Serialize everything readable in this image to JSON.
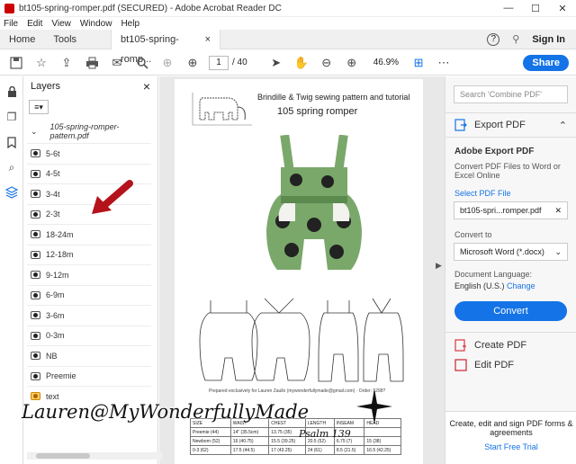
{
  "window": {
    "title": "bt105-spring-romper.pdf (SECURED) - Adobe Acrobat Reader DC",
    "minimize": "—",
    "maximize": "☐",
    "close": "✕"
  },
  "menu": [
    "File",
    "Edit",
    "View",
    "Window",
    "Help"
  ],
  "tabs": {
    "home": "Home",
    "tools": "Tools",
    "doc": "bt105-spring-romp...",
    "doc_close": "×"
  },
  "header_right": {
    "help_icon": "?",
    "bell_icon": "🔔",
    "signin": "Sign In"
  },
  "toolbar": {
    "page_current": "1",
    "page_total": "/ 40",
    "zoom": "46.9%",
    "share": "Share"
  },
  "layers_panel": {
    "title": "Layers",
    "close": "×",
    "root_label": "105-spring-romper-pattern.pdf",
    "items": [
      "5-6t",
      "4-5t",
      "3-4t",
      "2-3t",
      "18-24m",
      "12-18m",
      "9-12m",
      "6-9m",
      "3-6m",
      "0-3m",
      "NB",
      "Preemie",
      "text"
    ]
  },
  "page": {
    "title_line1": "Brindille & Twig sewing pattern and tutorial",
    "title_line2": "105 spring romper",
    "prepared": "Prepared exclusively for Lauren Zaullo (mywonderfullymade@gmail.com) · Order: 1298?",
    "table_rows": [
      [
        "SIZE",
        "WAIST",
        "CHEST",
        "LENGTH",
        "INSEAM",
        "HEAD"
      ],
      [
        "Preemie (44)",
        "14\" (35.5cm)",
        "13.75 (35)",
        "",
        "",
        ""
      ],
      [
        "Newborn (52)",
        "16 (40.75)",
        "15.5 (39.25)",
        "20.5 (52)",
        "6.75 (7)",
        "15 (38)"
      ],
      [
        "0-3 (62)",
        "17.5 (44.5)",
        "17 (43.25)",
        "24 (61)",
        "8.5 (21.5)",
        "16.5 (42.25)"
      ]
    ]
  },
  "right_panel": {
    "search_placeholder": "Search 'Combine PDF'",
    "export_title": "Export PDF",
    "adobe_export": "Adobe Export PDF",
    "export_desc": "Convert PDF Files to Word or Excel Online",
    "select_file": "Select PDF File",
    "file_name": "bt105-spri...romper.pdf",
    "convert_to": "Convert to",
    "format": "Microsoft Word (*.docx)",
    "doc_language": "Document Language:",
    "language": "English (U.S.)",
    "change": "Change",
    "convert": "Convert",
    "create_pdf": "Create PDF",
    "edit_pdf": "Edit PDF",
    "promo_text": "Create, edit and sign PDF forms & agreements",
    "free_trial": "Start Free Trial"
  },
  "watermark": {
    "text": "Lauren@MyWonderfullyMade",
    "sub": "Psalm 139"
  },
  "colors": {
    "accent": "#1473e6",
    "arrow": "#b5121b",
    "fabric": "#7aa86a"
  }
}
